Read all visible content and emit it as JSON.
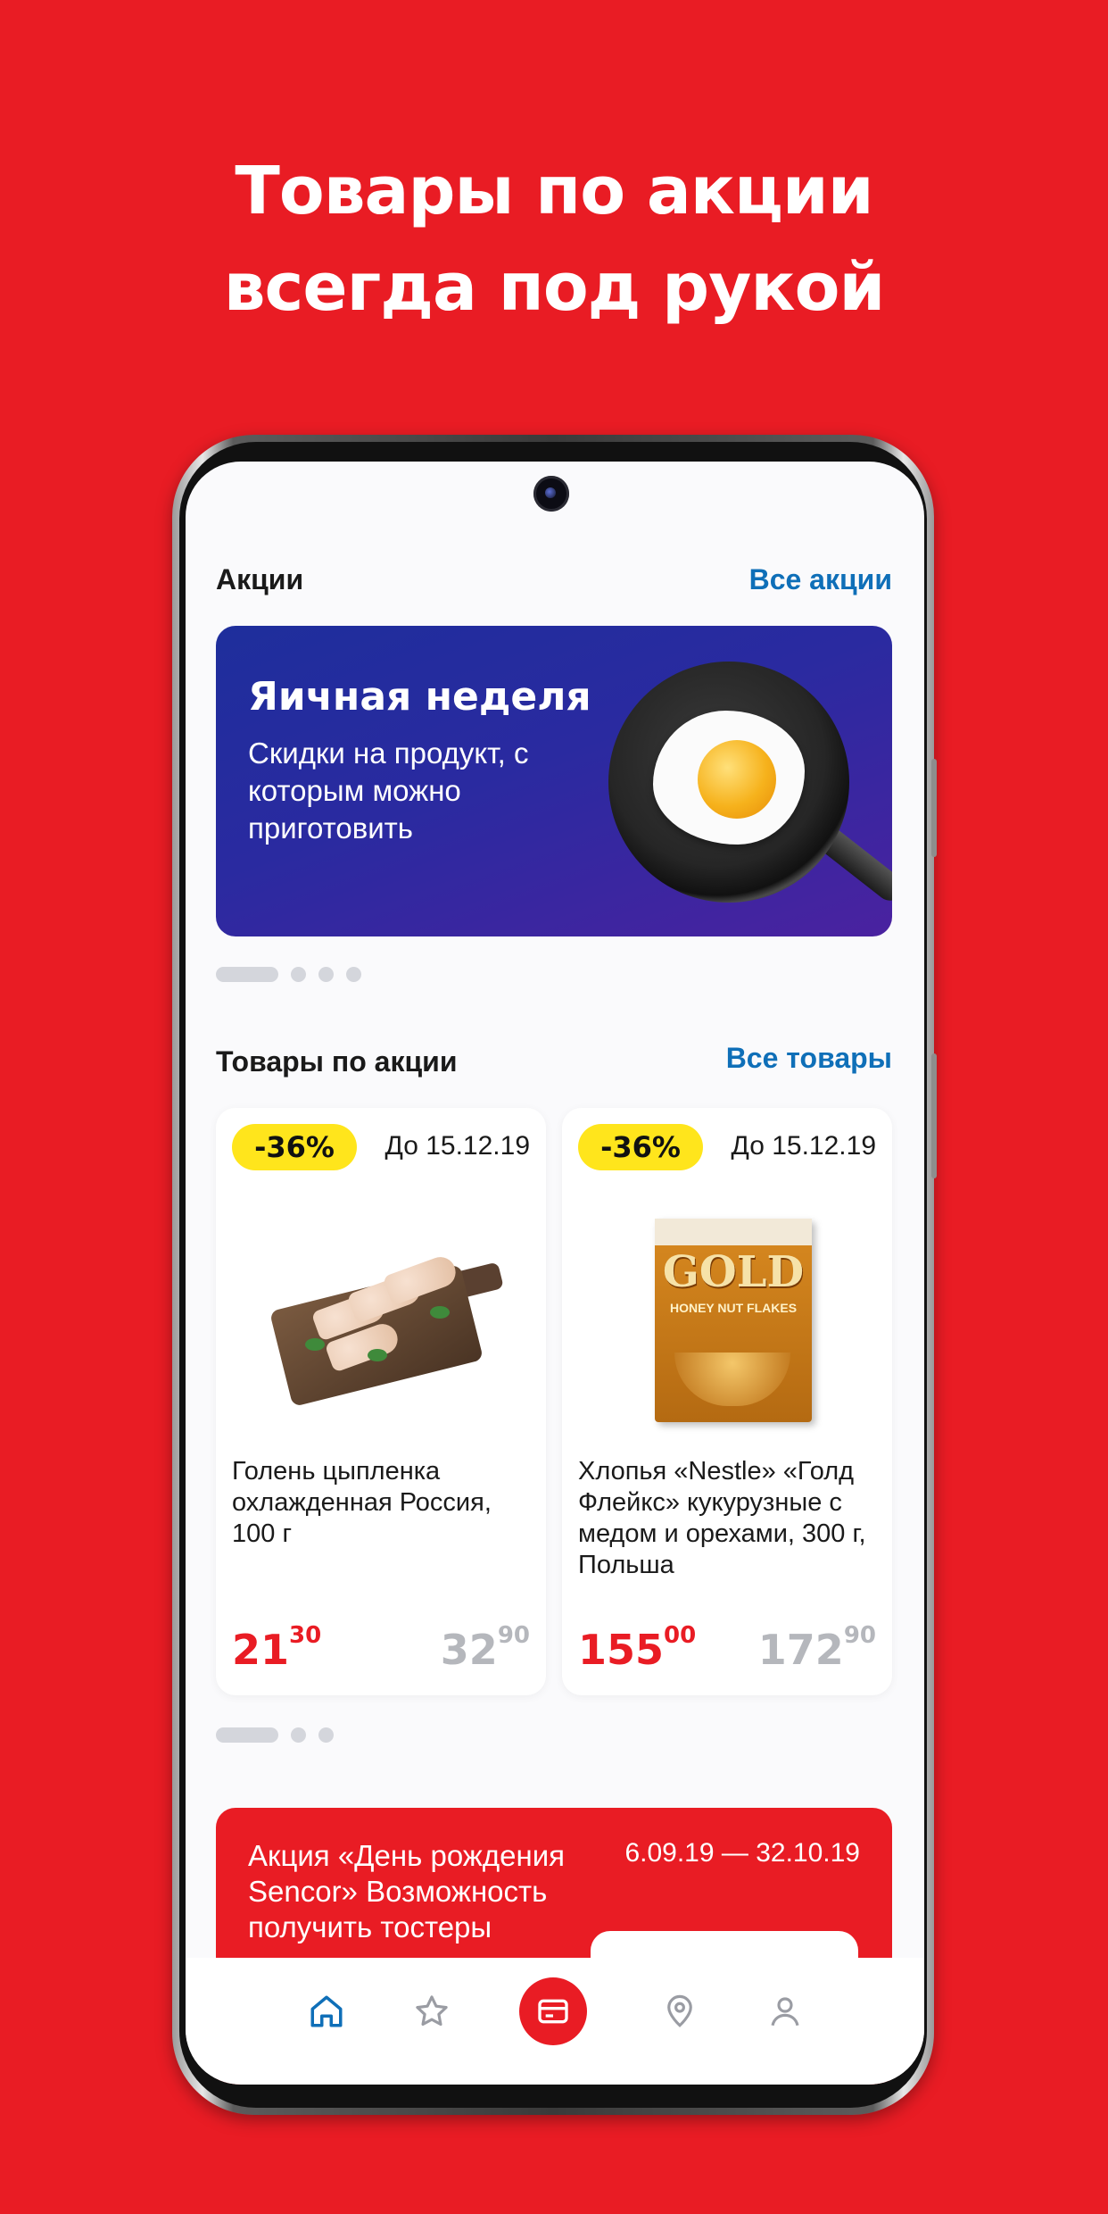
{
  "headline": {
    "line1": "Товары по акции",
    "line2": "всегда под рукой"
  },
  "promotions_section": {
    "title": "Акции",
    "link": "Все акции"
  },
  "banner": {
    "title": "Яичная неделя",
    "text": "Скидки на продукт, с которым можно приготовить",
    "pager": {
      "total": 4,
      "active": 1
    }
  },
  "products_section": {
    "title": "Товары по акции",
    "link": "Все товары",
    "pager": {
      "total": 3,
      "active": 1
    }
  },
  "products": [
    {
      "badge": "-36%",
      "until": "До 15.12.19",
      "name": "Голень цыпленка охлажденная Россия, 100 г",
      "price_main": "21",
      "price_cents": "30",
      "old_price_main": "32",
      "old_price_cents": "90"
    },
    {
      "badge": "-36%",
      "until": "До 15.12.19",
      "name": "Хлопья «Nestle» «Голд Флейкс» кукурузные с медом и орехами, 300 г, Польша",
      "price_main": "155",
      "price_cents": "00",
      "old_price_main": "172",
      "old_price_cents": "90",
      "package_brand": "GOLD",
      "package_sub": "HONEY NUT FLAKES"
    }
  ],
  "promo_card": {
    "title": "Акция «День рождения Sencor» Возможность получить тостеры",
    "dates": "6.09.19 — 32.10.19"
  },
  "navbar": {
    "items": [
      "home-icon",
      "star-icon",
      "card-icon",
      "location-pin-icon",
      "profile-icon"
    ],
    "active": "home-icon"
  },
  "colors": {
    "brand_red": "#E91C24",
    "link_blue": "#0F6FB8",
    "badge_yellow": "#FFE51C",
    "banner_blue": "#2A2AA0"
  }
}
